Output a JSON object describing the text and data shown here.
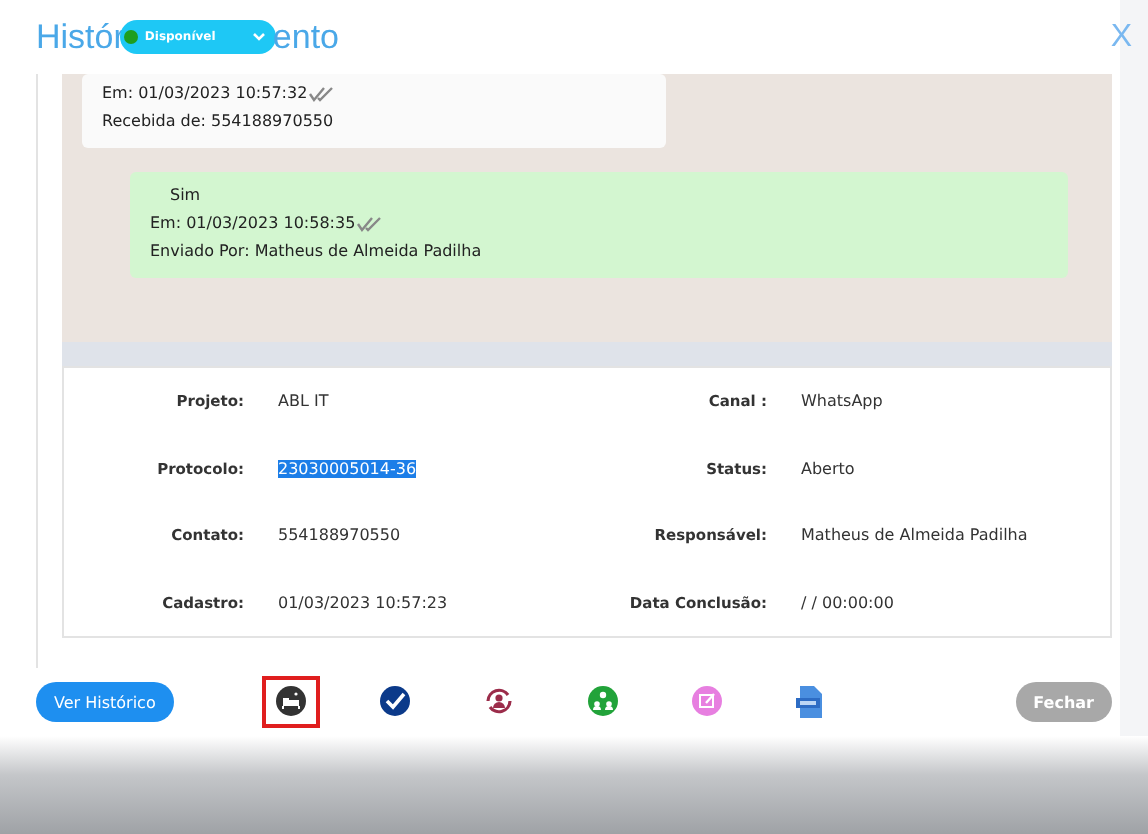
{
  "header": {
    "title_start": "Histór",
    "title_end": "ento",
    "status": {
      "label": "Disponível",
      "color": "#1e9e1e"
    },
    "close": "X"
  },
  "messages": [
    {
      "sent": false,
      "lines": [
        "Em: 01/03/2023 10:57:32",
        "Recebida de: 554188970550"
      ]
    },
    {
      "sent": true,
      "lines": [
        "Sim",
        "Em: 01/03/2023 10:58:35",
        "Enviado Por: Matheus de Almeida Padilha"
      ]
    }
  ],
  "details": [
    {
      "label": "Projeto:",
      "value": "ABL IT",
      "highlighted": false
    },
    {
      "label": "Canal :",
      "value": "WhatsApp",
      "highlighted": false
    },
    {
      "label": "Protocolo:",
      "value": "23030005014-36",
      "highlighted": true
    },
    {
      "label": "Status:",
      "value": "Aberto",
      "highlighted": false
    },
    {
      "label": "Contato:",
      "value": "554188970550",
      "highlighted": false
    },
    {
      "label": "Responsável:",
      "value": "Matheus de Almeida Padilha",
      "highlighted": false
    },
    {
      "label": "Cadastro:",
      "value": "01/03/2023 10:57:23",
      "highlighted": false
    },
    {
      "label": "Data Conclusão:",
      "value": "/ / 00:00:00",
      "highlighted": false
    }
  ],
  "footer": {
    "history_button": "Ver Histórico",
    "close_button": {
      "label": "Fechar",
      "disabled": true
    },
    "actions": [
      {
        "kind": "bed",
        "selected": true
      },
      {
        "kind": "check",
        "selected": false
      },
      {
        "kind": "transfer",
        "selected": false
      },
      {
        "kind": "group",
        "selected": false
      },
      {
        "kind": "note",
        "selected": false
      },
      {
        "kind": "pdf",
        "selected": false
      }
    ]
  }
}
